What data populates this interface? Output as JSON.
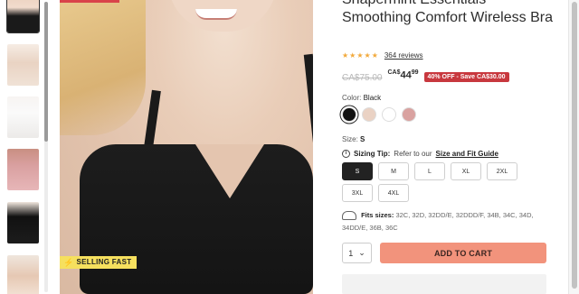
{
  "product": {
    "title": "Shapermint Essentials Smoothing Comfort Wireless Bra",
    "rating_stars": "★★★★★",
    "reviews_text": "364 reviews",
    "old_price": "CA$75.00",
    "price_currency": "CA$",
    "price_whole": "44",
    "price_cents": "99",
    "discount_badge": "40% OFF - Save CA$30.00",
    "selling_badge": "SELLING FAST"
  },
  "color": {
    "label": "Color:",
    "selected": "Black",
    "swatches": [
      "#111111",
      "#ead2c4",
      "#ffffff",
      "#d9a2a0"
    ]
  },
  "size": {
    "label": "Size:",
    "selected": "S",
    "tip_label": "Sizing Tip:",
    "tip_text": "Refer to our",
    "tip_link": "Size and Fit Guide",
    "options": [
      "S",
      "M",
      "L",
      "XL",
      "2XL",
      "3XL",
      "4XL"
    ]
  },
  "fits": {
    "label": "Fits sizes:",
    "text": "32C, 32D, 32DD/E, 32DDD/F, 34B, 34C, 34D, 34DD/E, 36B, 36C"
  },
  "cart": {
    "quantity": "1",
    "add_label": "ADD TO CART"
  }
}
